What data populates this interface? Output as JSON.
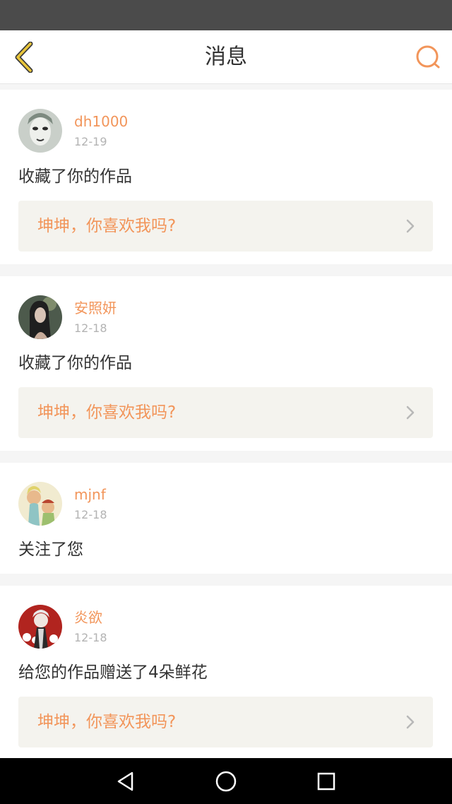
{
  "header": {
    "title": "消息",
    "back_icon": "chevron-left-icon",
    "search_icon": "search-icon"
  },
  "colors": {
    "accent": "#f2955a",
    "back_icon": "#e8c53a",
    "status_bar": "#4b4b4b",
    "work_bg": "#f4f3ee"
  },
  "messages": [
    {
      "username": "dh1000",
      "date": "12-19",
      "action": "收藏了你的作品",
      "work_title": "坤坤，你喜欢我吗?"
    },
    {
      "username": "安照妍",
      "date": "12-18",
      "action": "收藏了你的作品",
      "work_title": "坤坤，你喜欢我吗?"
    },
    {
      "username": "mjnf",
      "date": "12-18",
      "action": "关注了您",
      "work_title": ""
    },
    {
      "username": "炎欲",
      "date": "12-18",
      "action": "给您的作品赠送了4朵鲜花",
      "work_title": "坤坤，你喜欢我吗?"
    }
  ],
  "system_nav": {
    "back_icon": "triangle-back-icon",
    "home_icon": "circle-home-icon",
    "recents_icon": "square-recents-icon"
  }
}
